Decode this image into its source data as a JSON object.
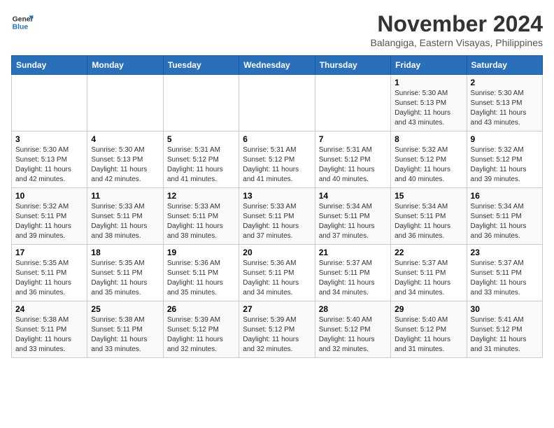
{
  "header": {
    "logo_line1": "General",
    "logo_line2": "Blue",
    "month": "November 2024",
    "location": "Balangiga, Eastern Visayas, Philippines"
  },
  "days_of_week": [
    "Sunday",
    "Monday",
    "Tuesday",
    "Wednesday",
    "Thursday",
    "Friday",
    "Saturday"
  ],
  "weeks": [
    [
      {
        "day": "",
        "info": ""
      },
      {
        "day": "",
        "info": ""
      },
      {
        "day": "",
        "info": ""
      },
      {
        "day": "",
        "info": ""
      },
      {
        "day": "",
        "info": ""
      },
      {
        "day": "1",
        "info": "Sunrise: 5:30 AM\nSunset: 5:13 PM\nDaylight: 11 hours\nand 43 minutes."
      },
      {
        "day": "2",
        "info": "Sunrise: 5:30 AM\nSunset: 5:13 PM\nDaylight: 11 hours\nand 43 minutes."
      }
    ],
    [
      {
        "day": "3",
        "info": "Sunrise: 5:30 AM\nSunset: 5:13 PM\nDaylight: 11 hours\nand 42 minutes."
      },
      {
        "day": "4",
        "info": "Sunrise: 5:30 AM\nSunset: 5:13 PM\nDaylight: 11 hours\nand 42 minutes."
      },
      {
        "day": "5",
        "info": "Sunrise: 5:31 AM\nSunset: 5:12 PM\nDaylight: 11 hours\nand 41 minutes."
      },
      {
        "day": "6",
        "info": "Sunrise: 5:31 AM\nSunset: 5:12 PM\nDaylight: 11 hours\nand 41 minutes."
      },
      {
        "day": "7",
        "info": "Sunrise: 5:31 AM\nSunset: 5:12 PM\nDaylight: 11 hours\nand 40 minutes."
      },
      {
        "day": "8",
        "info": "Sunrise: 5:32 AM\nSunset: 5:12 PM\nDaylight: 11 hours\nand 40 minutes."
      },
      {
        "day": "9",
        "info": "Sunrise: 5:32 AM\nSunset: 5:12 PM\nDaylight: 11 hours\nand 39 minutes."
      }
    ],
    [
      {
        "day": "10",
        "info": "Sunrise: 5:32 AM\nSunset: 5:11 PM\nDaylight: 11 hours\nand 39 minutes."
      },
      {
        "day": "11",
        "info": "Sunrise: 5:33 AM\nSunset: 5:11 PM\nDaylight: 11 hours\nand 38 minutes."
      },
      {
        "day": "12",
        "info": "Sunrise: 5:33 AM\nSunset: 5:11 PM\nDaylight: 11 hours\nand 38 minutes."
      },
      {
        "day": "13",
        "info": "Sunrise: 5:33 AM\nSunset: 5:11 PM\nDaylight: 11 hours\nand 37 minutes."
      },
      {
        "day": "14",
        "info": "Sunrise: 5:34 AM\nSunset: 5:11 PM\nDaylight: 11 hours\nand 37 minutes."
      },
      {
        "day": "15",
        "info": "Sunrise: 5:34 AM\nSunset: 5:11 PM\nDaylight: 11 hours\nand 36 minutes."
      },
      {
        "day": "16",
        "info": "Sunrise: 5:34 AM\nSunset: 5:11 PM\nDaylight: 11 hours\nand 36 minutes."
      }
    ],
    [
      {
        "day": "17",
        "info": "Sunrise: 5:35 AM\nSunset: 5:11 PM\nDaylight: 11 hours\nand 36 minutes."
      },
      {
        "day": "18",
        "info": "Sunrise: 5:35 AM\nSunset: 5:11 PM\nDaylight: 11 hours\nand 35 minutes."
      },
      {
        "day": "19",
        "info": "Sunrise: 5:36 AM\nSunset: 5:11 PM\nDaylight: 11 hours\nand 35 minutes."
      },
      {
        "day": "20",
        "info": "Sunrise: 5:36 AM\nSunset: 5:11 PM\nDaylight: 11 hours\nand 34 minutes."
      },
      {
        "day": "21",
        "info": "Sunrise: 5:37 AM\nSunset: 5:11 PM\nDaylight: 11 hours\nand 34 minutes."
      },
      {
        "day": "22",
        "info": "Sunrise: 5:37 AM\nSunset: 5:11 PM\nDaylight: 11 hours\nand 34 minutes."
      },
      {
        "day": "23",
        "info": "Sunrise: 5:37 AM\nSunset: 5:11 PM\nDaylight: 11 hours\nand 33 minutes."
      }
    ],
    [
      {
        "day": "24",
        "info": "Sunrise: 5:38 AM\nSunset: 5:11 PM\nDaylight: 11 hours\nand 33 minutes."
      },
      {
        "day": "25",
        "info": "Sunrise: 5:38 AM\nSunset: 5:11 PM\nDaylight: 11 hours\nand 33 minutes."
      },
      {
        "day": "26",
        "info": "Sunrise: 5:39 AM\nSunset: 5:12 PM\nDaylight: 11 hours\nand 32 minutes."
      },
      {
        "day": "27",
        "info": "Sunrise: 5:39 AM\nSunset: 5:12 PM\nDaylight: 11 hours\nand 32 minutes."
      },
      {
        "day": "28",
        "info": "Sunrise: 5:40 AM\nSunset: 5:12 PM\nDaylight: 11 hours\nand 32 minutes."
      },
      {
        "day": "29",
        "info": "Sunrise: 5:40 AM\nSunset: 5:12 PM\nDaylight: 11 hours\nand 31 minutes."
      },
      {
        "day": "30",
        "info": "Sunrise: 5:41 AM\nSunset: 5:12 PM\nDaylight: 11 hours\nand 31 minutes."
      }
    ]
  ]
}
